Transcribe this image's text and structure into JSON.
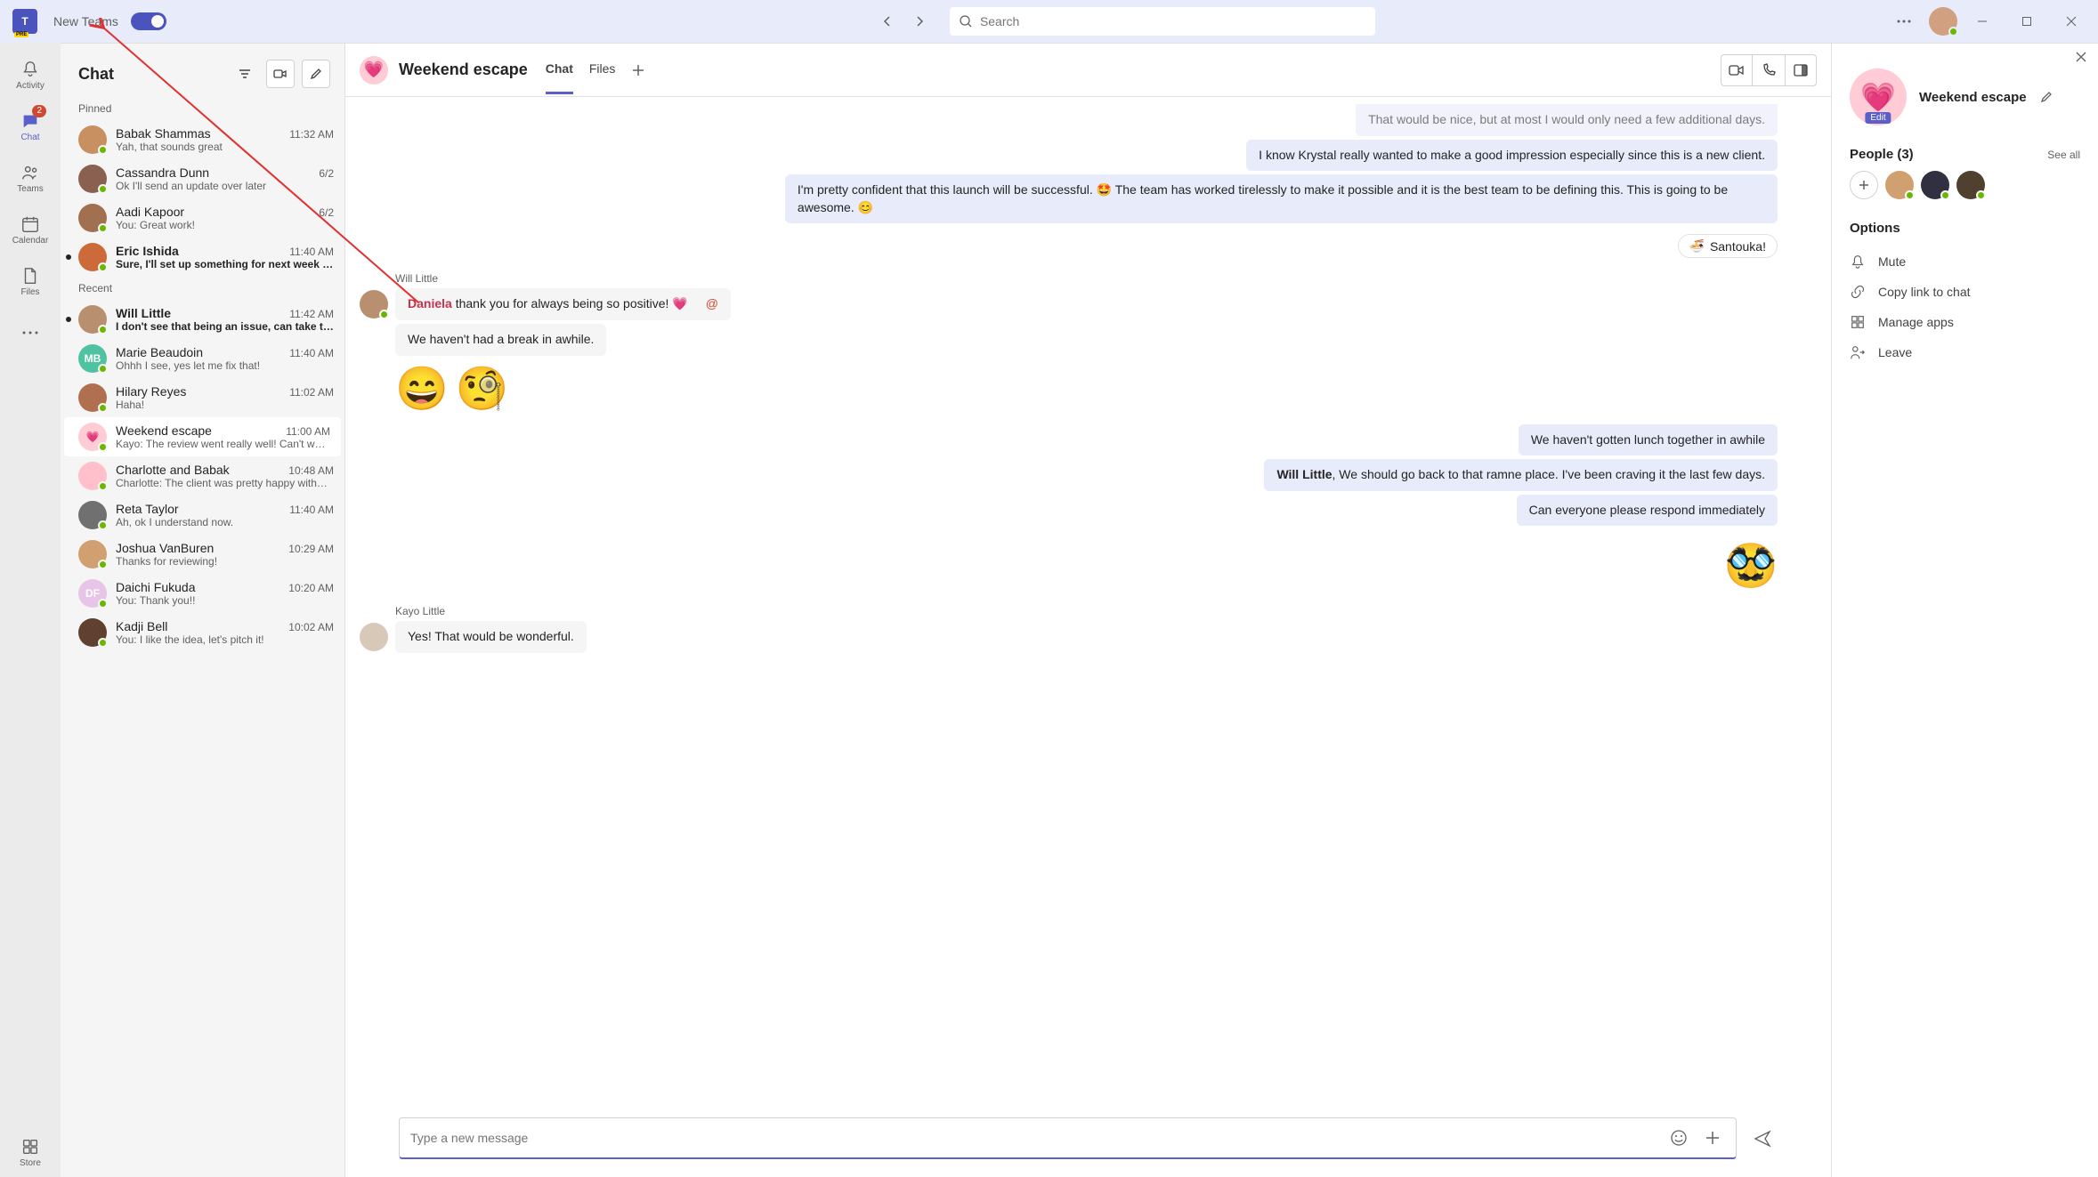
{
  "titlebar": {
    "new_teams_label": "New Teams",
    "search_placeholder": "Search"
  },
  "rail": {
    "activity": "Activity",
    "chat": "Chat",
    "chat_badge": "2",
    "teams": "Teams",
    "calendar": "Calendar",
    "files": "Files",
    "store": "Store"
  },
  "chatlist": {
    "title": "Chat",
    "pinned_label": "Pinned",
    "recent_label": "Recent",
    "pinned": [
      {
        "name": "Babak Shammas",
        "time": "11:32 AM",
        "preview": "Yah, that sounds great",
        "color": "#c89060"
      },
      {
        "name": "Cassandra Dunn",
        "time": "6/2",
        "preview": "Ok I'll send an update over later",
        "color": "#8a6050"
      },
      {
        "name": "Aadi Kapoor",
        "time": "6/2",
        "preview": "You: Great work!",
        "color": "#a07050"
      },
      {
        "name": "Eric Ishida",
        "time": "11:40 AM",
        "preview": "Sure, I'll set up something for next week to…",
        "color": "#cc6a3a",
        "unread": true
      }
    ],
    "recent": [
      {
        "name": "Will Little",
        "time": "11:42 AM",
        "preview": "I don't see that being an issue, can take t…",
        "color": "#b89070",
        "unread": true
      },
      {
        "name": "Marie Beaudoin",
        "time": "11:40 AM",
        "preview": "Ohhh I see, yes let me fix that!",
        "initials": "MB",
        "color": "#4fc3a1"
      },
      {
        "name": "Hilary Reyes",
        "time": "11:02 AM",
        "preview": "Haha!",
        "color": "#b07050"
      },
      {
        "name": "Weekend escape",
        "time": "11:00 AM",
        "preview": "Kayo: The review went really well! Can't wai…",
        "heart": true,
        "selected": true
      },
      {
        "name": "Charlotte and Babak",
        "time": "10:48 AM",
        "preview": "Charlotte: The client was pretty happy with…",
        "pair": true
      },
      {
        "name": "Reta Taylor",
        "time": "11:40 AM",
        "preview": "Ah, ok I understand now.",
        "color": "#707070"
      },
      {
        "name": "Joshua VanBuren",
        "time": "10:29 AM",
        "preview": "Thanks for reviewing!",
        "color": "#d0a070"
      },
      {
        "name": "Daichi Fukuda",
        "time": "10:20 AM",
        "preview": "You: Thank you!!",
        "initials": "DF",
        "color": "#e8c4e8"
      },
      {
        "name": "Kadji Bell",
        "time": "10:02 AM",
        "preview": "You: I like the idea, let's pitch it!",
        "color": "#604030"
      }
    ]
  },
  "conversation": {
    "title": "Weekend escape",
    "tabs": {
      "chat": "Chat",
      "files": "Files"
    },
    "messages": {
      "m0": "That would be nice, but at most I would only need a few additional days.",
      "m1": "I know Krystal really wanted to make a good impression especially since this is a new client.",
      "m2": "I'm pretty confident that this launch will be successful. 🤩 The team has worked tirelessly to make it possible and it is the best team to be defining this. This is going to be awesome. 😊",
      "santouka": "Santouka!",
      "will_sender": "Will Little",
      "will_1a_mention": "Daniela",
      "will_1a_rest": " thank you for always being so positive! 💗",
      "will_1b": "We haven't had a break in awhile.",
      "mine_1": "We haven't gotten lunch together in awhile",
      "mine_2_mention": "Will Little",
      "mine_2_rest": ", We should go back to that ramne place. I've been craving it the last few days.",
      "mine_3": "Can everyone please respond immediately",
      "kayo_sender": "Kayo Little",
      "kayo_1": "Yes! That would be wonderful."
    },
    "compose_placeholder": "Type a new message"
  },
  "details": {
    "name": "Weekend escape",
    "edit_badge": "Edit",
    "people_title": "People (3)",
    "see_all": "See all",
    "options_title": "Options",
    "mute": "Mute",
    "copy": "Copy link to chat",
    "apps": "Manage apps",
    "leave": "Leave"
  }
}
